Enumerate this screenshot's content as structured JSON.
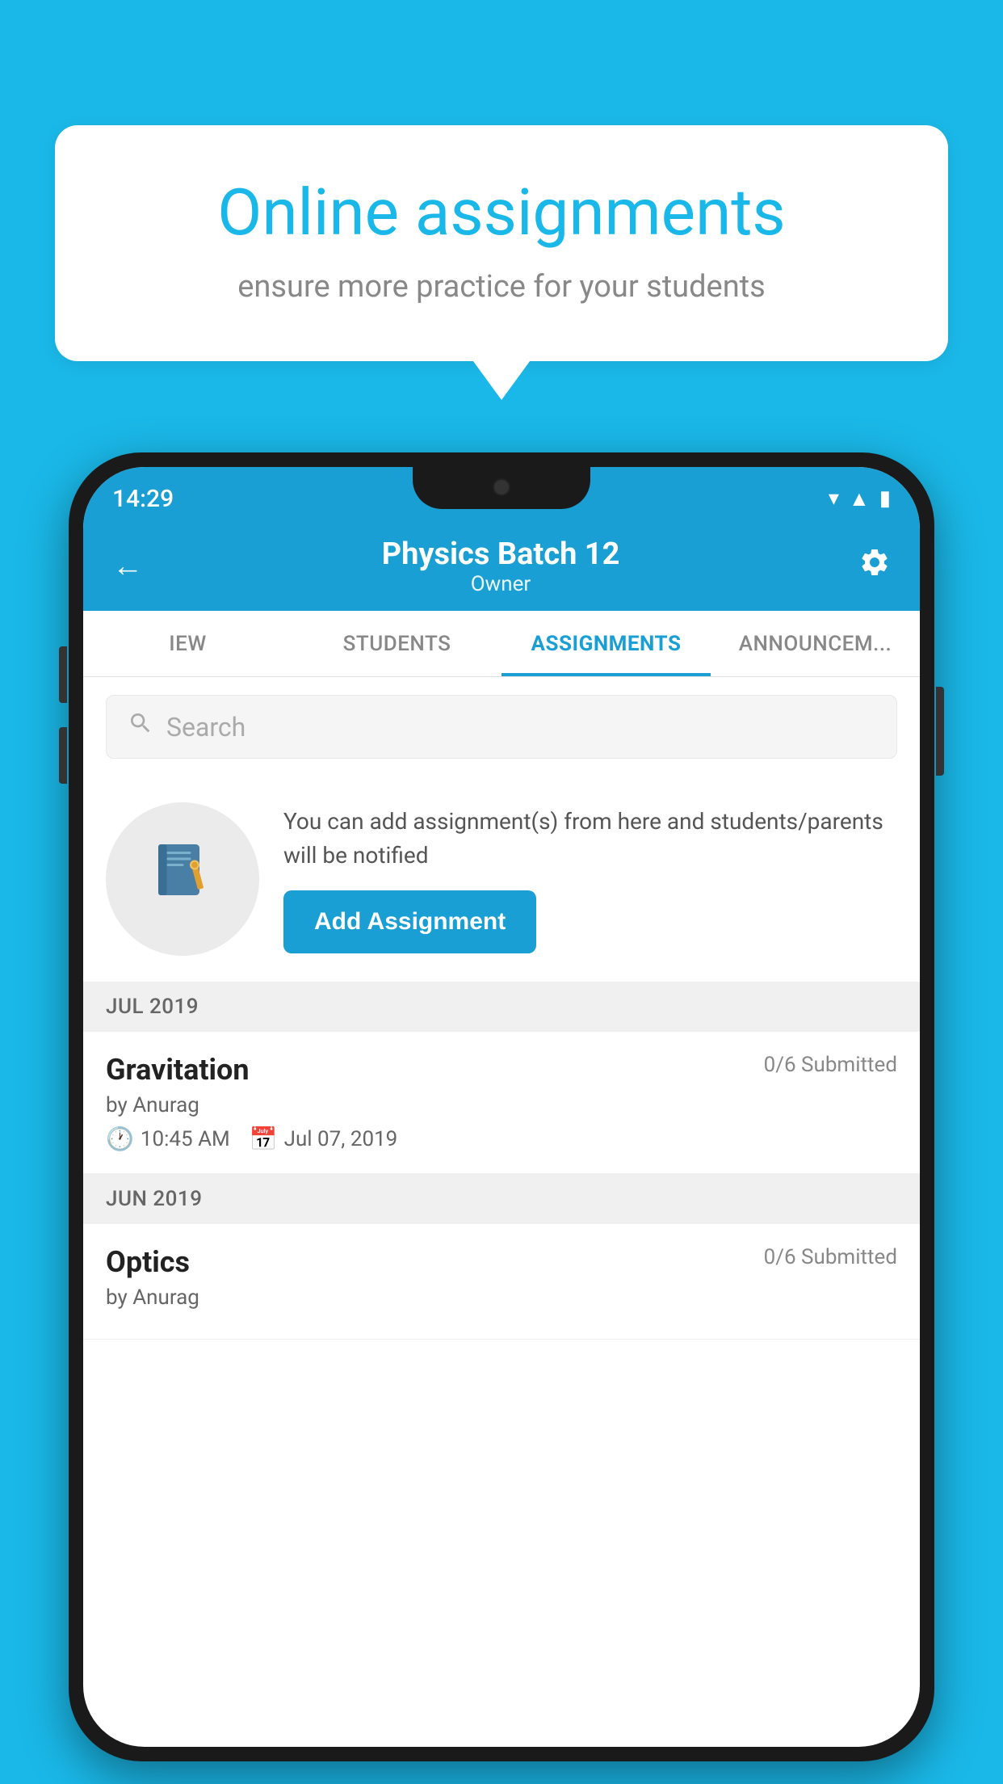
{
  "background_color": "#1ab8e8",
  "speech_bubble": {
    "title": "Online assignments",
    "subtitle": "ensure more practice for your students"
  },
  "phone": {
    "status_bar": {
      "time": "14:29",
      "wifi_icon": "wifi",
      "signal_icon": "signal",
      "battery_icon": "battery"
    },
    "header": {
      "title": "Physics Batch 12",
      "subtitle": "Owner",
      "back_label": "←",
      "settings_label": "⚙"
    },
    "tabs": [
      {
        "id": "iew",
        "label": "IEW",
        "active": false
      },
      {
        "id": "students",
        "label": "STUDENTS",
        "active": false
      },
      {
        "id": "assignments",
        "label": "ASSIGNMENTS",
        "active": true
      },
      {
        "id": "announcements",
        "label": "ANNOUNCEM...",
        "active": false
      }
    ],
    "search": {
      "placeholder": "Search"
    },
    "promo": {
      "description": "You can add assignment(s) from here and students/parents will be notified",
      "button_label": "Add Assignment"
    },
    "sections": [
      {
        "label": "JUL 2019",
        "assignments": [
          {
            "name": "Gravitation",
            "submitted": "0/6 Submitted",
            "by": "by Anurag",
            "time": "10:45 AM",
            "date": "Jul 07, 2019"
          }
        ]
      },
      {
        "label": "JUN 2019",
        "assignments": [
          {
            "name": "Optics",
            "submitted": "0/6 Submitted",
            "by": "by Anurag",
            "time": "",
            "date": ""
          }
        ]
      }
    ]
  }
}
